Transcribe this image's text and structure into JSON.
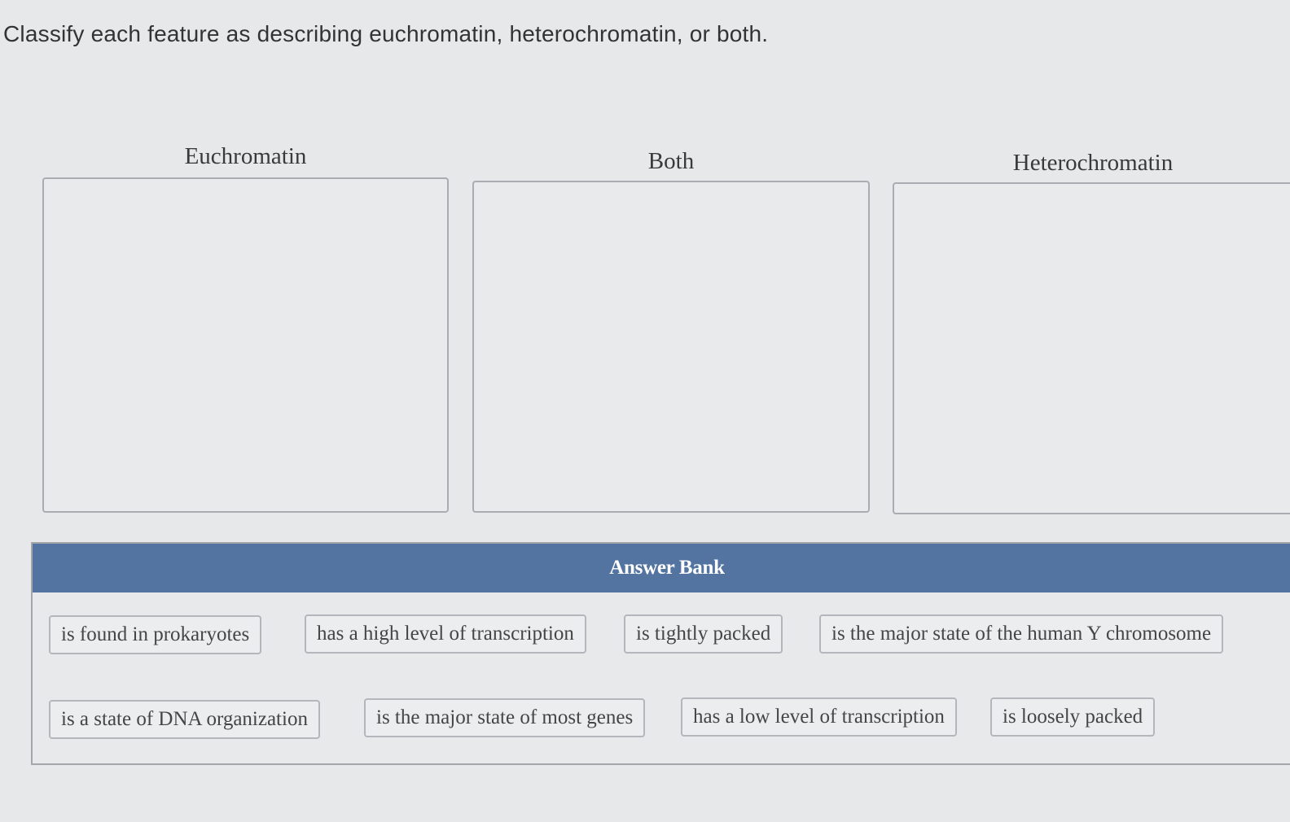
{
  "question": {
    "prompt": "Classify each feature as describing euchromatin, heterochromatin, or both."
  },
  "bins": [
    {
      "label": "Euchromatin"
    },
    {
      "label": "Both"
    },
    {
      "label": "Heterochromatin"
    }
  ],
  "answer_bank": {
    "title": "Answer Bank",
    "items": [
      {
        "label": "is found in prokaryotes"
      },
      {
        "label": "has a high level of transcription"
      },
      {
        "label": "is tightly packed"
      },
      {
        "label": "is the major state of the human Y chromosome"
      },
      {
        "label": "is a state of DNA organization"
      },
      {
        "label": "is the major state of most genes"
      },
      {
        "label": "has a low level of transcription"
      },
      {
        "label": "is loosely packed"
      }
    ]
  },
  "colors": {
    "header": "#5373a0",
    "background": "#e7e8ea",
    "border": "#a9acb0"
  }
}
